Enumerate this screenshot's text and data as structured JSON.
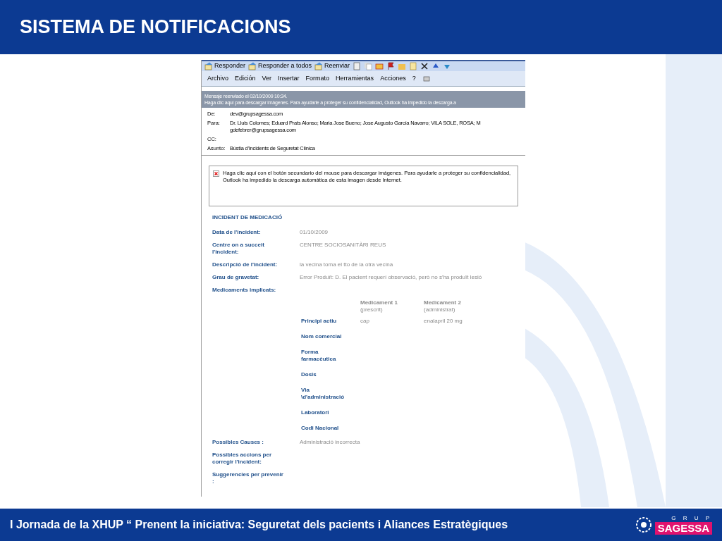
{
  "slide": {
    "title": "SISTEMA DE NOTIFICACIONS",
    "footer": "I Jornada de la XHUP “ Prenent la iniciativa: Seguretat dels pacients i Aliances Estratègiques",
    "logo": {
      "top": "G R U P",
      "name": "SAGESSA"
    }
  },
  "email": {
    "toolbar": [
      "Responder",
      "Responder a todos",
      "Reenviar"
    ],
    "menu": [
      "Archivo",
      "Edición",
      "Ver",
      "Insertar",
      "Formato",
      "Herramientas",
      "Acciones",
      "?"
    ],
    "info_bar": [
      "Mensaje reenviado el 02/10/2009 10:34.",
      "Haga clic aquí para descargar imágenes. Para ayudarle a proteger su confidencialidad, Outlook ha impedido la descarga a"
    ],
    "headers": [
      {
        "label": "De:",
        "lines": [
          "dev@grupsagessa.com"
        ]
      },
      {
        "label": "Para:",
        "lines": [
          "Dr. Lluis Colomes; Eduard Prats Alonso; Maria Jose Bueno; Jose Augusto García Navarro; VILA SOLE, ROSA; M",
          "gdefebrer@grupsagessa.com"
        ]
      },
      {
        "label": "CC:"
      },
      {
        "label": "Asunto:",
        "lines": [
          "Bústia d'Incidents de Seguretat Clínica"
        ]
      }
    ],
    "blocked_image": "Haga clic aquí con el botón secundario del mouse para descargar imágenes. Para ayudarle a proteger su confidencialidad, Outlook ha impedido la descarga automática de esta imagen desde Internet.",
    "form": {
      "title": "INCIDENT DE MEDICACIÓ",
      "fields": [
        {
          "label": "Data de l'incident:",
          "value": "01/10/2009"
        },
        {
          "label": "Centre on a succeit l'incident:",
          "value": "CENTRE SOCIOSANITÀRI REUS"
        },
        {
          "label": "Descripció de l'incident:",
          "value": "la vecina toma el tto de la otra vecina"
        },
        {
          "label": "Grau de gravetat:",
          "value": "Error Produït: D. El pacient requerí observació, però no s'ha produït lesió"
        },
        {
          "label": "Medicaments implicats:"
        }
      ],
      "medicaments": {
        "columns": [
          {
            "title": "Medicament 1",
            "subtitle": "(prescrit)"
          },
          {
            "title": "Medicament 2",
            "subtitle": "(administrat)"
          }
        ],
        "rows": [
          {
            "label": "Principi actiu",
            "values": [
              "cap",
              "enalapril 20 mg"
            ]
          },
          {
            "label": "Nom comercial"
          },
          {
            "label": "Forma farmacèutica"
          },
          {
            "label": "Dosis"
          },
          {
            "label": "Via \\d'administració"
          },
          {
            "label": "Laboratori"
          },
          {
            "label": "Codi Nacional"
          }
        ]
      },
      "after_fields": [
        {
          "label": "Possibles Causes :",
          "value": "Administració incorrecta"
        },
        {
          "label": "Possibles accions per corregir l'incident:"
        },
        {
          "label": "Suggerencies per prevenir :"
        }
      ]
    }
  }
}
